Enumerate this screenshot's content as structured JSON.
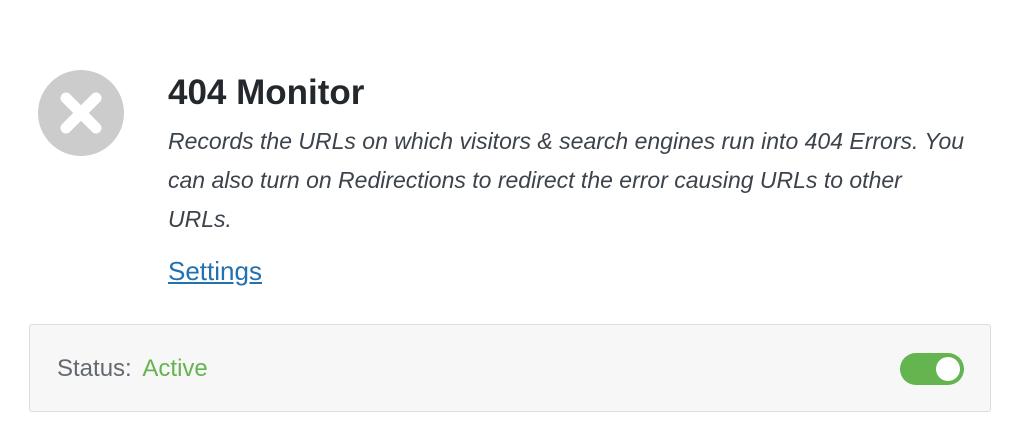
{
  "module": {
    "title": "404 Monitor",
    "description": "Records the URLs on which visitors & search engines run into 404 Errors. You can also turn on Redirections to redirect the error causing URLs to other URLs.",
    "icon": "close-circle-icon",
    "settings_label": "Settings",
    "status": {
      "label": "Status:",
      "value": "Active",
      "toggle_on": true
    }
  },
  "colors": {
    "title": "#23282d",
    "link": "#2271b1",
    "active": "#64b450",
    "icon": "#cccccc"
  }
}
